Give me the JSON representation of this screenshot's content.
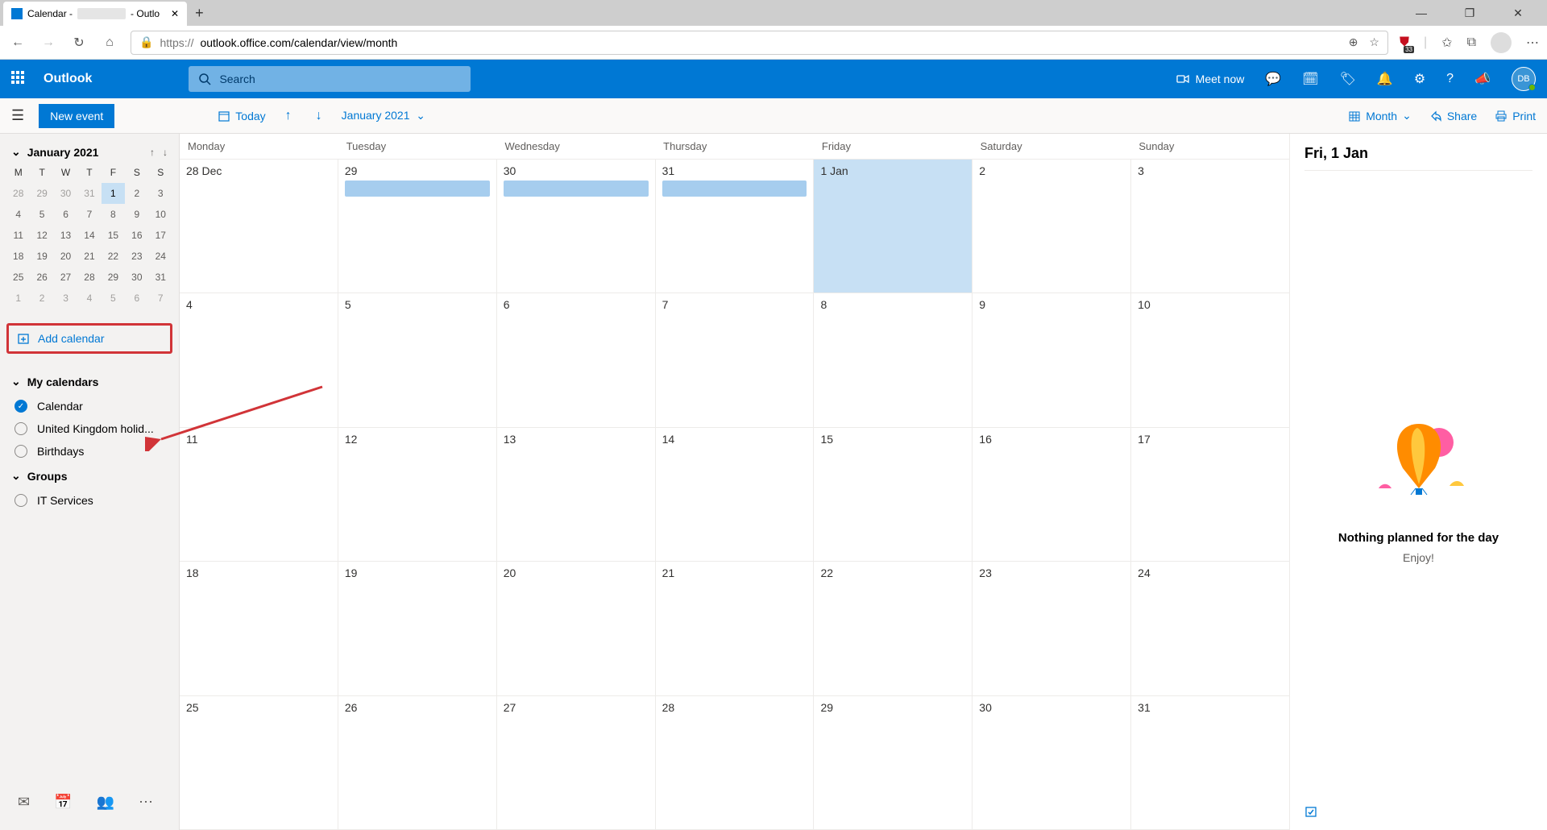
{
  "browser": {
    "tab_prefix": "Calendar -",
    "tab_suffix": "- Outlo",
    "url_prefix": "https://",
    "url": "outlook.office.com/calendar/view/month",
    "ext_badge": "33"
  },
  "header": {
    "app_name": "Outlook",
    "search_placeholder": "Search",
    "meet_now": "Meet now",
    "avatar_initials": "DB"
  },
  "cmdbar": {
    "new_event": "New event",
    "today": "Today",
    "month_year": "January 2021",
    "view": "Month",
    "share": "Share",
    "print": "Print"
  },
  "mini_cal": {
    "title": "January 2021",
    "dow": [
      "M",
      "T",
      "W",
      "T",
      "F",
      "S",
      "S"
    ],
    "rows": [
      [
        "28",
        "29",
        "30",
        "31",
        "1",
        "2",
        "3"
      ],
      [
        "4",
        "5",
        "6",
        "7",
        "8",
        "9",
        "10"
      ],
      [
        "11",
        "12",
        "13",
        "14",
        "15",
        "16",
        "17"
      ],
      [
        "18",
        "19",
        "20",
        "21",
        "22",
        "23",
        "24"
      ],
      [
        "25",
        "26",
        "27",
        "28",
        "29",
        "30",
        "31"
      ],
      [
        "1",
        "2",
        "3",
        "4",
        "5",
        "6",
        "7"
      ]
    ]
  },
  "sidebar": {
    "add_calendar": "Add calendar",
    "my_calendars": "My calendars",
    "calendars": [
      "Calendar",
      "United Kingdom holid...",
      "Birthdays"
    ],
    "groups_label": "Groups",
    "groups": [
      "IT Services"
    ]
  },
  "grid": {
    "dow": [
      "Monday",
      "Tuesday",
      "Wednesday",
      "Thursday",
      "Friday",
      "Saturday",
      "Sunday"
    ],
    "weeks": [
      [
        "28 Dec",
        "29",
        "30",
        "31",
        "1 Jan",
        "2",
        "3"
      ],
      [
        "4",
        "5",
        "6",
        "7",
        "8",
        "9",
        "10"
      ],
      [
        "11",
        "12",
        "13",
        "14",
        "15",
        "16",
        "17"
      ],
      [
        "18",
        "19",
        "20",
        "21",
        "22",
        "23",
        "24"
      ],
      [
        "25",
        "26",
        "27",
        "28",
        "29",
        "30",
        "31"
      ]
    ]
  },
  "detail": {
    "title": "Fri, 1 Jan",
    "empty_title": "Nothing planned for the day",
    "empty_sub": "Enjoy!"
  }
}
